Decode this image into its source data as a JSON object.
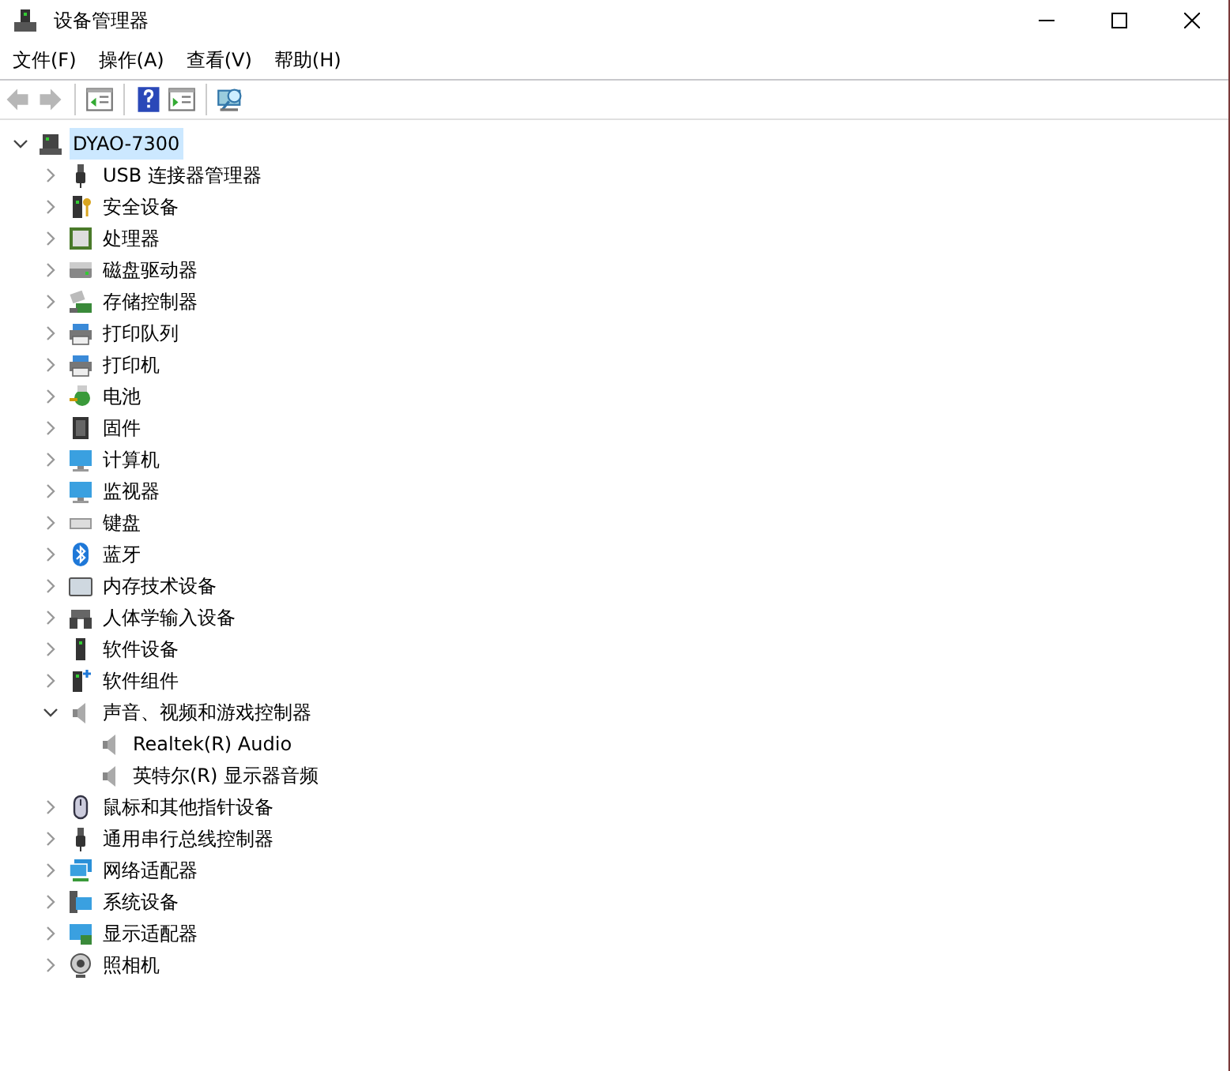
{
  "window": {
    "title": "设备管理器"
  },
  "menu": [
    "文件(F)",
    "操作(A)",
    "查看(V)",
    "帮助(H)"
  ],
  "toolbar": [
    {
      "kind": "back",
      "disabled": true
    },
    {
      "kind": "forward",
      "disabled": true
    },
    {
      "kind": "separator"
    },
    {
      "kind": "tree",
      "disabled": false
    },
    {
      "kind": "separator"
    },
    {
      "kind": "help",
      "disabled": false
    },
    {
      "kind": "panel",
      "disabled": false
    },
    {
      "kind": "separator"
    },
    {
      "kind": "scan",
      "disabled": false
    }
  ],
  "tree": {
    "label": "DYAO-7300",
    "expanded": true,
    "selected": true,
    "children": [
      {
        "label": "USB 连接器管理器",
        "expanded": false
      },
      {
        "label": "安全设备",
        "expanded": false
      },
      {
        "label": "处理器",
        "expanded": false
      },
      {
        "label": "磁盘驱动器",
        "expanded": false
      },
      {
        "label": "存储控制器",
        "expanded": false
      },
      {
        "label": "打印队列",
        "expanded": false
      },
      {
        "label": "打印机",
        "expanded": false
      },
      {
        "label": "电池",
        "expanded": false
      },
      {
        "label": "固件",
        "expanded": false
      },
      {
        "label": "计算机",
        "expanded": false
      },
      {
        "label": "监视器",
        "expanded": false
      },
      {
        "label": "键盘",
        "expanded": false
      },
      {
        "label": "蓝牙",
        "expanded": false
      },
      {
        "label": "内存技术设备",
        "expanded": false
      },
      {
        "label": "人体学输入设备",
        "expanded": false
      },
      {
        "label": "软件设备",
        "expanded": false
      },
      {
        "label": "软件组件",
        "expanded": false
      },
      {
        "label": "声音、视频和游戏控制器",
        "expanded": true,
        "children": [
          {
            "label": "Realtek(R) Audio"
          },
          {
            "label": "英特尔(R) 显示器音频"
          }
        ]
      },
      {
        "label": "鼠标和其他指针设备",
        "expanded": false
      },
      {
        "label": "通用串行总线控制器",
        "expanded": false
      },
      {
        "label": "网络适配器",
        "expanded": false
      },
      {
        "label": "系统设备",
        "expanded": false
      },
      {
        "label": "显示适配器",
        "expanded": false
      },
      {
        "label": "照相机",
        "expanded": false
      }
    ]
  }
}
